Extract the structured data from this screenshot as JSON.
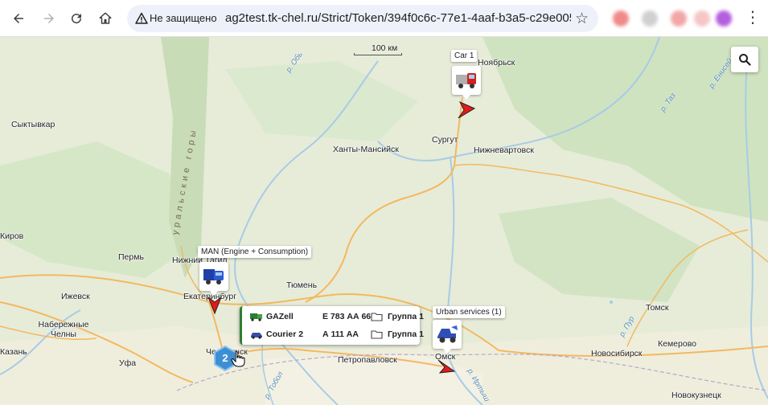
{
  "browser": {
    "security_label": "Не защищено",
    "url": "ag2test.tk-chel.ru/Strict/Token/394f0c6c-77e1-4aaf-b3a5-c29e005a..."
  },
  "map": {
    "scale_label": "100 км",
    "cities": [
      {
        "name": "Сыктывкар"
      },
      {
        "name": "Ханты-Мансийск"
      },
      {
        "name": "Сургут"
      },
      {
        "name": "Нижневартовск"
      },
      {
        "name": "Киров"
      },
      {
        "name": "Пермь"
      },
      {
        "name": "Нижний Тагил"
      },
      {
        "name": "Екатеринбург"
      },
      {
        "name": "Тюмень"
      },
      {
        "name": "Ижевск"
      },
      {
        "name": "Набережные Челны"
      },
      {
        "name": "Челябинск"
      },
      {
        "name": "Уфа"
      },
      {
        "name": "Петропавловск"
      },
      {
        "name": "Омск"
      },
      {
        "name": "Новосибирск"
      },
      {
        "name": "Кемерово"
      },
      {
        "name": "Томск"
      },
      {
        "name": "Новокузнецк"
      },
      {
        "name": "Ноябрьск"
      },
      {
        "name": "Казань"
      }
    ],
    "rivers": [
      {
        "name": "р. Обь"
      },
      {
        "name": "р. Таз"
      },
      {
        "name": "р. Енисей"
      },
      {
        "name": "р. Тобол"
      },
      {
        "name": "р. Иртыш"
      },
      {
        "name": "р. Пур"
      }
    ],
    "mountain_label": "уральские горы"
  },
  "vehicles": [
    {
      "label": "Car 1",
      "icon": "red-truck-icon"
    },
    {
      "label": "MAN (Engine + Consumption)",
      "icon": "blue-truck-icon"
    },
    {
      "label": "Urban services (1)",
      "icon": "blue-loader-icon"
    }
  ],
  "cluster": {
    "count": "2",
    "items": [
      {
        "name": "GAZell",
        "plate": "Е 783 АА 66",
        "group": "Группа 1",
        "icon": "green-truck-icon"
      },
      {
        "name": "Courier 2",
        "plate": "А 111 АА",
        "group": "Группа 1",
        "icon": "car-icon"
      }
    ]
  },
  "colors": {
    "land": "#e6ecd8",
    "forest": "#cfe3c0",
    "road": "#f4b860",
    "water": "#a8cbe6",
    "arrow": "#e01b1b",
    "cluster": "#3d8fd4"
  }
}
